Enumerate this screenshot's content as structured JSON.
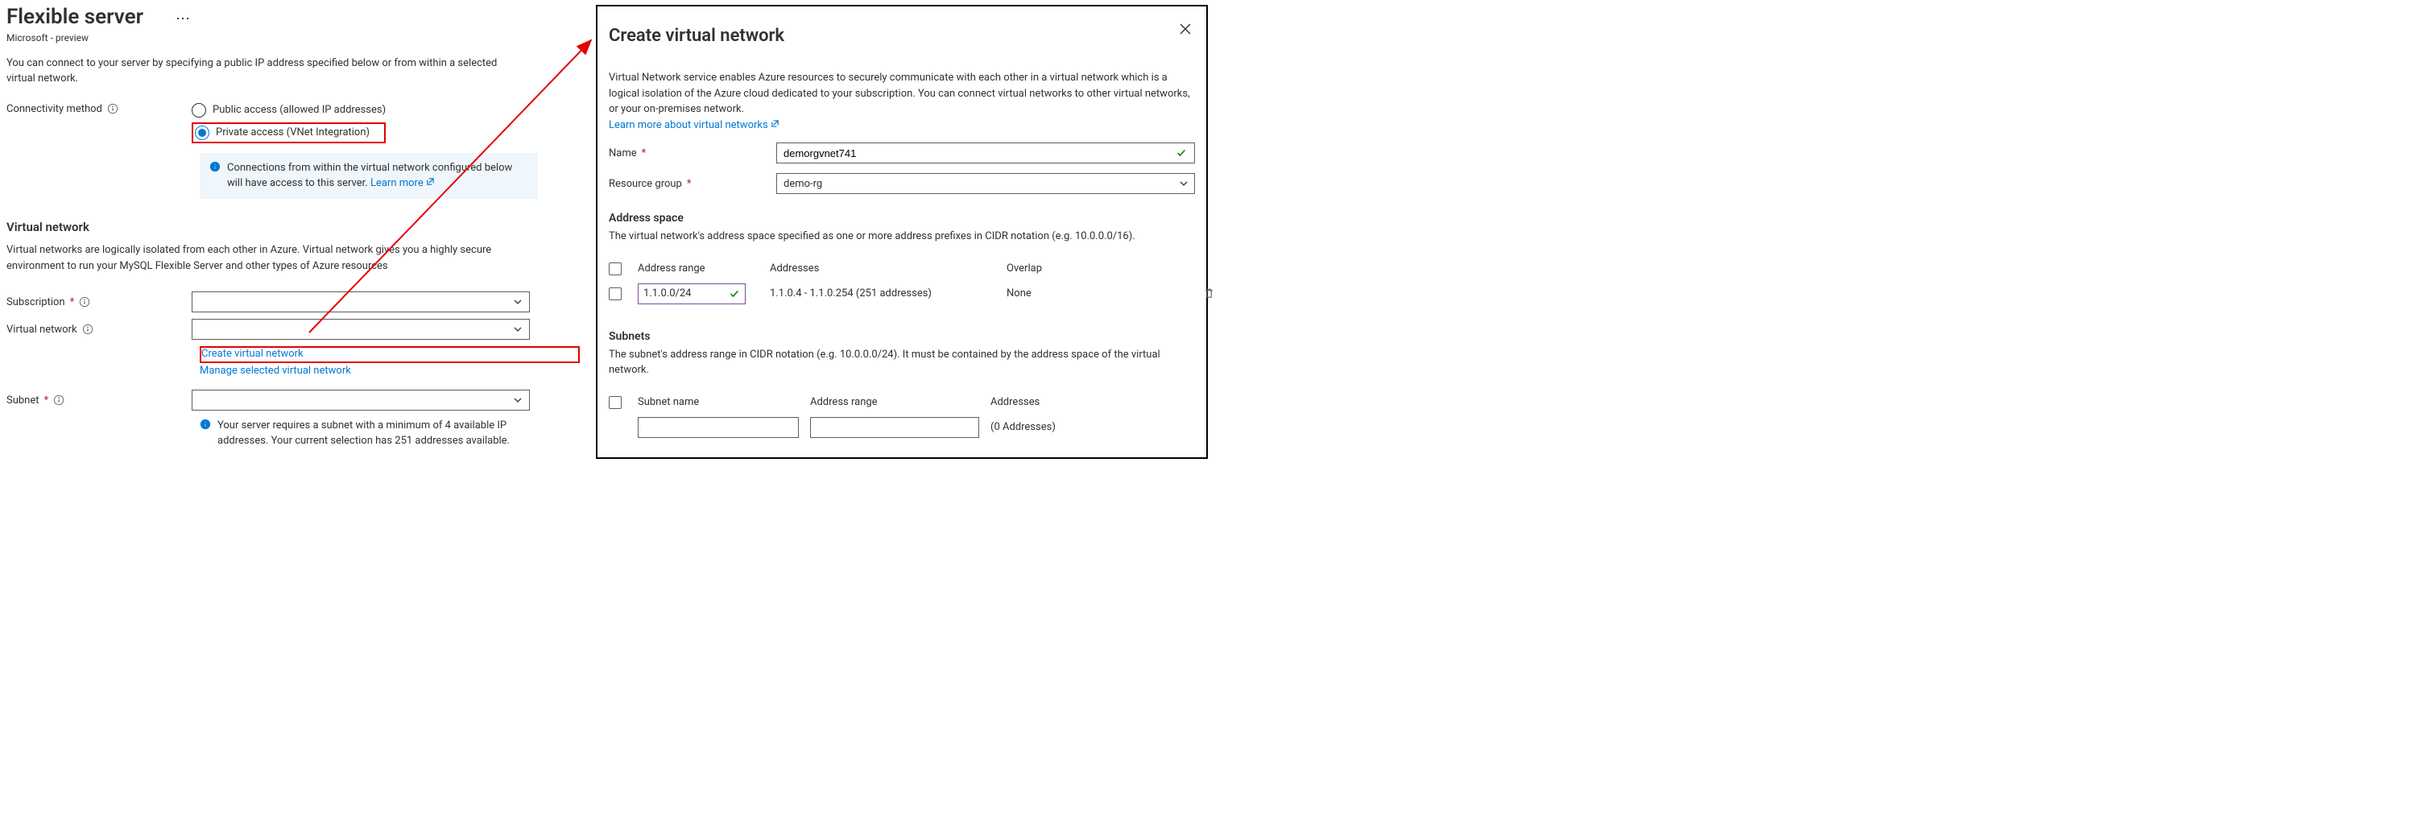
{
  "left": {
    "title": "Flexible server",
    "subtitle": "Microsoft - preview",
    "lead": "You can connect to your server by specifying a public IP address specified below or from within a selected virtual network.",
    "connectivity_label": "Connectivity method",
    "radio_public": "Public access (allowed IP addresses)",
    "radio_private": "Private access (VNet Integration)",
    "info_banner": "Connections from within the virtual network configured below will have access to this server.",
    "info_banner_link": "Learn more",
    "vnet_heading": "Virtual network",
    "vnet_desc": "Virtual networks are logically isolated from each other in Azure. Virtual network gives you a highly secure environment to run your MySQL Flexible Server and other types of Azure resources",
    "subscription_label": "Subscription",
    "virtual_network_label": "Virtual network",
    "create_vnet_link": "Create virtual network",
    "manage_vnet_link": "Manage selected virtual network",
    "subnet_label": "Subnet",
    "subnet_helper": "Your server requires a subnet with a minimum of 4 available IP addresses. Your current selection has 251 addresses available.",
    "subscription_value": "",
    "vnet_value": "",
    "subnet_value": ""
  },
  "right": {
    "title": "Create virtual network",
    "lead": "Virtual Network service enables Azure resources to securely communicate with each other in a virtual network which is a logical isolation of the Azure cloud dedicated to your subscription. You can connect virtual networks to other virtual networks, or your on-premises network.",
    "lead_link": "Learn more about virtual networks",
    "name_label": "Name",
    "name_value": "demorgvnet741",
    "rg_label": "Resource group",
    "rg_value": "demo-rg",
    "addr_space_heading": "Address space",
    "addr_space_desc": "The virtual network's address space specified as one or more address prefixes in CIDR notation (e.g. 10.0.0.0/16).",
    "addr_cols": {
      "range": "Address range",
      "addresses": "Addresses",
      "overlap": "Overlap"
    },
    "addr_rows": [
      {
        "range": "1.1.0.0/24",
        "addresses": "1.1.0.4 - 1.1.0.254 (251 addresses)",
        "overlap": "None"
      }
    ],
    "subnets_heading": "Subnets",
    "subnets_desc": "The subnet's address range in CIDR notation (e.g. 10.0.0.0/24). It must be contained by the address space of the virtual network.",
    "subnet_cols": {
      "name": "Subnet name",
      "range": "Address range",
      "addresses": "Addresses"
    },
    "subnet_rows": [
      {
        "name": "",
        "range": "",
        "addresses": "(0 Addresses)"
      }
    ]
  }
}
